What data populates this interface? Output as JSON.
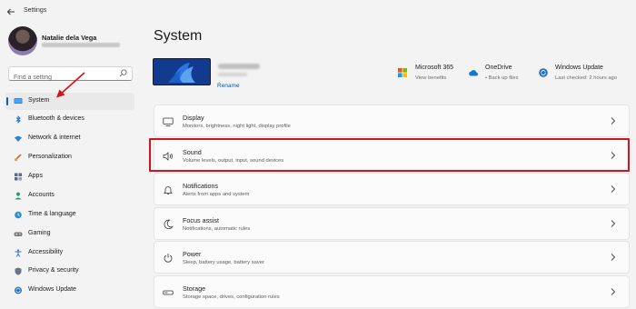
{
  "window": {
    "title": "Settings",
    "back_icon": "back-arrow-icon"
  },
  "user": {
    "name": "Natalie dela Vega"
  },
  "search": {
    "placeholder": "Find a setting"
  },
  "sidebar": {
    "items": [
      {
        "label": "System",
        "icon": "monitor-icon",
        "active": true
      },
      {
        "label": "Bluetooth & devices",
        "icon": "bluetooth-icon"
      },
      {
        "label": "Network & internet",
        "icon": "wifi-icon"
      },
      {
        "label": "Personalization",
        "icon": "brush-icon"
      },
      {
        "label": "Apps",
        "icon": "apps-icon"
      },
      {
        "label": "Accounts",
        "icon": "person-icon"
      },
      {
        "label": "Time & language",
        "icon": "globe-clock-icon"
      },
      {
        "label": "Gaming",
        "icon": "gamepad-icon"
      },
      {
        "label": "Accessibility",
        "icon": "accessibility-icon"
      },
      {
        "label": "Privacy & security",
        "icon": "shield-icon"
      },
      {
        "label": "Windows Update",
        "icon": "update-icon"
      }
    ]
  },
  "main": {
    "title": "System",
    "device": {
      "rename_label": "Rename"
    },
    "quick_links": [
      {
        "title": "Microsoft 365",
        "subtitle": "View benefits",
        "icon": "microsoft-logo-icon"
      },
      {
        "title": "OneDrive",
        "subtitle": "• Back up files",
        "icon": "onedrive-cloud-icon"
      },
      {
        "title": "Windows Update",
        "subtitle": "Last checked: 2 hours ago",
        "icon": "update-icon"
      }
    ],
    "cards": [
      {
        "title": "Display",
        "subtitle": "Monitors, brightness, night light, display profile",
        "icon": "display-icon"
      },
      {
        "title": "Sound",
        "subtitle": "Volume levels, output, input, sound devices",
        "icon": "speaker-icon"
      },
      {
        "title": "Notifications",
        "subtitle": "Alerts from apps and system",
        "icon": "bell-icon"
      },
      {
        "title": "Focus assist",
        "subtitle": "Notifications, automatic rules",
        "icon": "moon-icon"
      },
      {
        "title": "Power",
        "subtitle": "Sleep, battery usage, battery saver",
        "icon": "power-icon"
      },
      {
        "title": "Storage",
        "subtitle": "Storage space, drives, configuration rules",
        "icon": "storage-icon"
      }
    ]
  },
  "colors": {
    "accent": "#005fb8",
    "annotation_red": "#d2141c",
    "background": "#f3f3f3"
  }
}
